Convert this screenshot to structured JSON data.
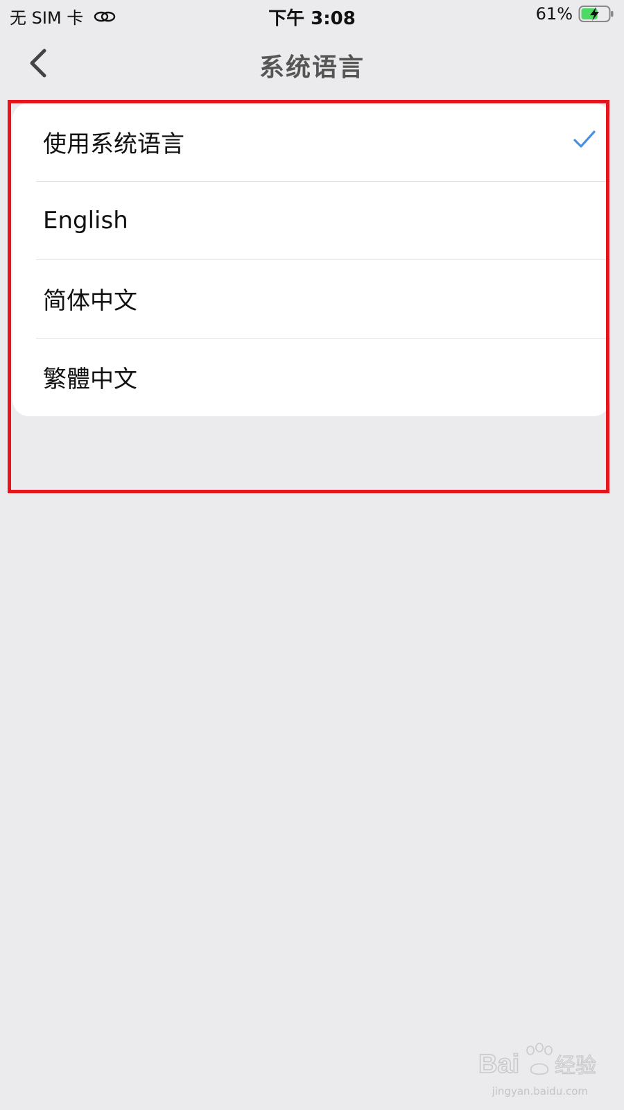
{
  "status_bar": {
    "carrier": "无 SIM 卡",
    "time": "下午 3:08",
    "battery": "61%",
    "battery_level": 0.61,
    "link_icon": "link-icon",
    "battery_icon": "battery-charging-icon"
  },
  "nav": {
    "title": "系统语言",
    "back_icon": "chevron-left-icon"
  },
  "languages": {
    "items": [
      {
        "label": "使用系统语言",
        "selected": true
      },
      {
        "label": "English",
        "selected": false
      },
      {
        "label": "简体中文",
        "selected": false
      },
      {
        "label": "繁體中文",
        "selected": false
      }
    ]
  },
  "watermark": {
    "sub": "jingyan.baidu.com"
  },
  "colors": {
    "background": "#ebebed",
    "check": "#4a90e2",
    "highlight": "#e8141b",
    "battery_fill": "#4cd964"
  }
}
